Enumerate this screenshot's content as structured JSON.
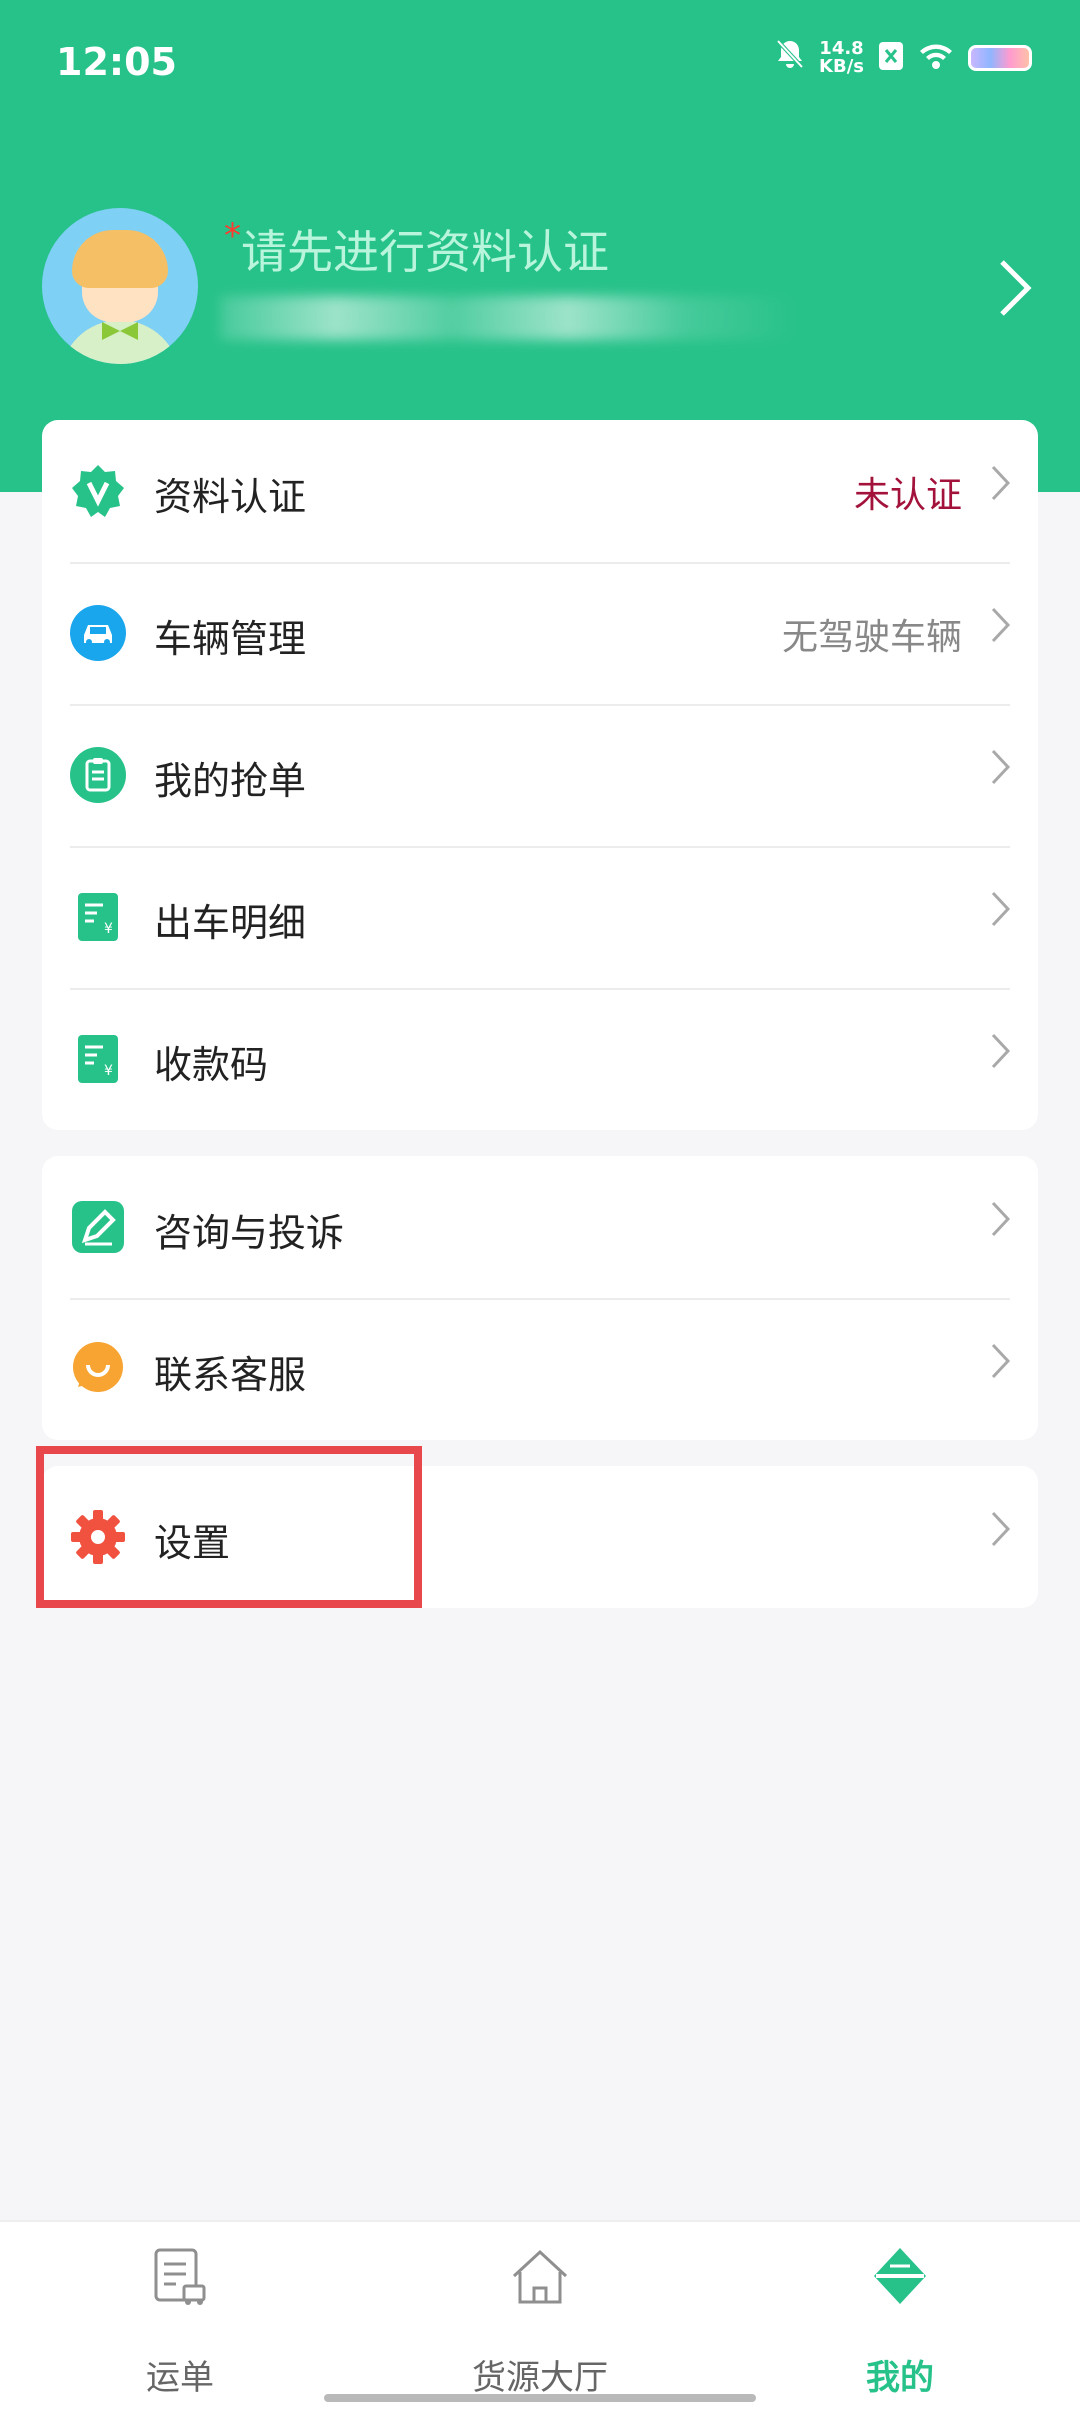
{
  "status_bar": {
    "time": "12:05",
    "net_speed_value": "14.8",
    "net_speed_unit": "KB/s"
  },
  "profile": {
    "required_mark": "*",
    "title": "请先进行资料认证"
  },
  "menu_group_1": [
    {
      "label": "资料认证",
      "value": "未认证",
      "icon": "verified-badge-icon"
    },
    {
      "label": "车辆管理",
      "value": "无驾驶车辆",
      "icon": "car-icon"
    },
    {
      "label": "我的抢单",
      "value": "",
      "icon": "clipboard-icon"
    },
    {
      "label": "出车明细",
      "value": "",
      "icon": "receipt-icon"
    },
    {
      "label": "收款码",
      "value": "",
      "icon": "receipt-icon"
    }
  ],
  "menu_group_2": [
    {
      "label": "咨询与投诉",
      "icon": "edit-icon"
    },
    {
      "label": "联系客服",
      "icon": "customer-service-icon"
    }
  ],
  "menu_group_3": [
    {
      "label": "设置",
      "icon": "gear-icon"
    }
  ],
  "tabbar": {
    "tabs": [
      {
        "label": "运单",
        "icon": "waybill-icon"
      },
      {
        "label": "货源大厅",
        "icon": "home-icon"
      },
      {
        "label": "我的",
        "icon": "profile-diamond-icon"
      }
    ],
    "active_index": 2
  },
  "colors": {
    "brand": "#27c28a",
    "warning_text": "#a3123b",
    "highlight": "#e8474b"
  }
}
